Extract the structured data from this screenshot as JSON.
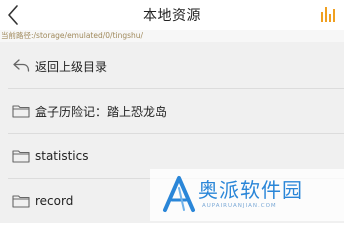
{
  "header": {
    "title": "本地资源",
    "back_icon": "back-chevron-icon",
    "right_icon": "equalizer-icon",
    "accent_color": "#f0a020"
  },
  "path_bar": {
    "text": "当前路径:/storage/emulated/0/tingshu/"
  },
  "list": {
    "items": [
      {
        "label": "返回上级目录",
        "icon": "return-arrow-icon"
      },
      {
        "label": "盒子历险记：踏上恐龙岛",
        "icon": "folder-icon"
      },
      {
        "label": "statistics",
        "icon": "folder-icon"
      },
      {
        "label": "record",
        "icon": "folder-icon"
      }
    ]
  },
  "watermark": {
    "text": "奥派软件园",
    "subtext": "AUPAIRUANJIAN.COM",
    "color": "#2a86d8"
  }
}
